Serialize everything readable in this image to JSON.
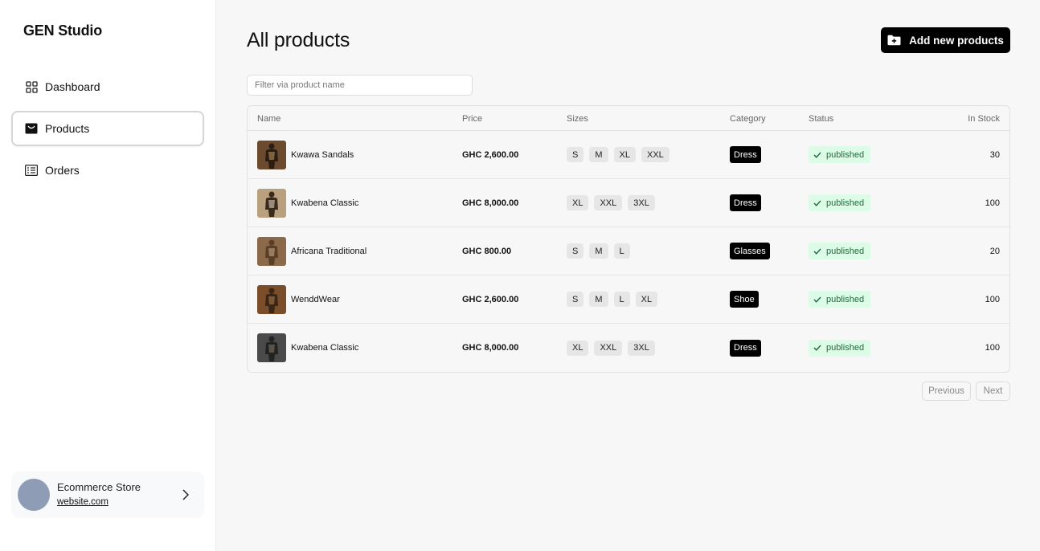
{
  "sidebar": {
    "brand": "GEN Studio",
    "items": [
      {
        "label": "Dashboard",
        "icon": "grid-icon"
      },
      {
        "label": "Products",
        "icon": "package-icon",
        "active": true
      },
      {
        "label": "Orders",
        "icon": "list-icon"
      }
    ],
    "account": {
      "name": "Ecommerce Store",
      "site": "website.com"
    }
  },
  "header": {
    "title": "All products",
    "add_label": "Add new products"
  },
  "filter": {
    "placeholder": "Filter via product name",
    "value": ""
  },
  "table": {
    "columns": {
      "name": "Name",
      "price": "Price",
      "sizes": "Sizes",
      "category": "Category",
      "status": "Status",
      "stock": "In Stock"
    },
    "rows": [
      {
        "name": "Kwawa Sandals",
        "price": "GHC 2,600.00",
        "sizes": [
          "S",
          "M",
          "XL",
          "XXL"
        ],
        "category": "Dress",
        "status": "published",
        "stock": "30"
      },
      {
        "name": "Kwabena Classic",
        "price": "GHC 8,000.00",
        "sizes": [
          "XL",
          "XXL",
          "3XL"
        ],
        "category": "Dress",
        "status": "published",
        "stock": "100"
      },
      {
        "name": "Africana Traditional",
        "price": "GHC 800.00",
        "sizes": [
          "S",
          "M",
          "L"
        ],
        "category": "Glasses",
        "status": "published",
        "stock": "20"
      },
      {
        "name": "WenddWear",
        "price": "GHC 2,600.00",
        "sizes": [
          "S",
          "M",
          "L",
          "XL"
        ],
        "category": "Shoe",
        "status": "published",
        "stock": "100"
      },
      {
        "name": "Kwabena Classic",
        "price": "GHC 8,000.00",
        "sizes": [
          "XL",
          "XXL",
          "3XL"
        ],
        "category": "Dress",
        "status": "published",
        "stock": "100"
      }
    ]
  },
  "pagination": {
    "previous": "Previous",
    "next": "Next"
  },
  "colors": {
    "accent": "#000000",
    "status_bg": "#dcfce7",
    "status_text": "#1e6b3a",
    "avatar": "#8e9db5"
  }
}
